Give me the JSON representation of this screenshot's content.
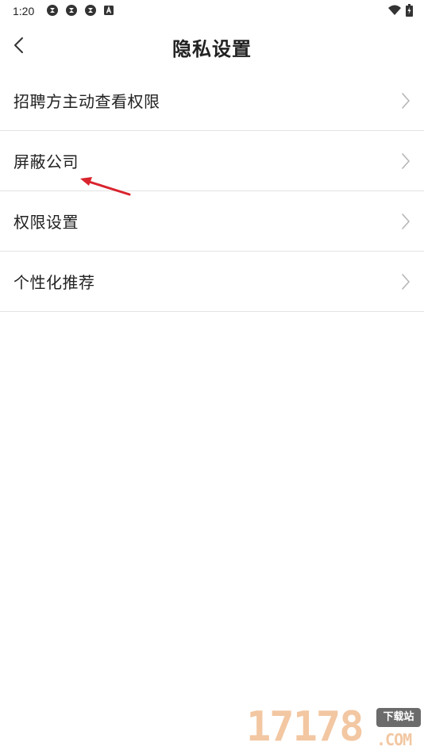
{
  "status_bar": {
    "time": "1:20",
    "left_icons": [
      "sync-icon",
      "sync-icon",
      "sync-icon",
      "a-icon"
    ],
    "right_icons": [
      "wifi-icon",
      "battery-icon"
    ]
  },
  "header": {
    "title": "隐私设置",
    "back_icon": "chevron-left-icon"
  },
  "menu": {
    "items": [
      {
        "label": "招聘方主动查看权限"
      },
      {
        "label": "屏蔽公司"
      },
      {
        "label": "权限设置"
      },
      {
        "label": "个性化推荐"
      }
    ]
  },
  "annotation": {
    "arrow_color": "#d9232d"
  },
  "watermark": {
    "digits": "17178",
    "badge": "下载站",
    "domain": ".COM"
  },
  "colors": {
    "background": "#ffffff",
    "text": "#222222",
    "divider": "#e3e3e3",
    "chevron": "#b8b8b8"
  }
}
